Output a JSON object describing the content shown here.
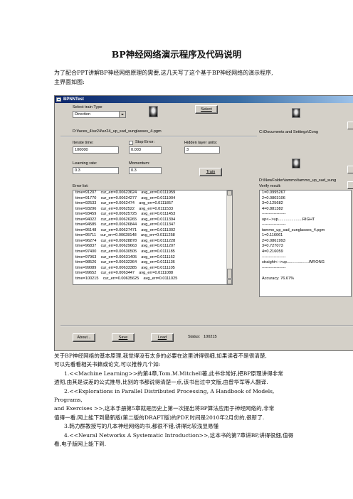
{
  "doc": {
    "title": "BP神经网络演示程序及代码说明",
    "intro_line1": "为了配合PPT讲解BP神经网络原理的需要,这几天写了这个基于BP神经网络的演示程序,",
    "intro_line2": "主界面如图:"
  },
  "window": {
    "title": "BPNNTest",
    "select_train_type_label": "Select train Type",
    "train_type_value": "Direction",
    "select_button": "Select",
    "train_path": "D:\\faces_4\\sz24\\sz24_up_sad_sunglasses_4.pgm",
    "iterate_time_label": "Iterate time:",
    "iterate_time_value": "100000",
    "stop_error_label": "Stop Error:",
    "stop_error_value": "0.003",
    "hidden_units_label": "Hidden layer units:",
    "hidden_units_value": "3",
    "learning_rate_label": "Learning rate:",
    "learning_rate_value": "0.3",
    "momentum_label": "Momentum:",
    "momentum_value": "0.3",
    "train_button": "Train",
    "error_list_label": "Error list:",
    "error_rows": [
      "time=91207    cur_err=0.00623624    avg_err=0.0111959",
      "time=91770    cur_err=0.00624277    avg_err=0.0111904",
      "time=92533    cur_err=0.0062474    avg_err=0.0111857",
      "time=93296    cur_err=0.0062522    avg_err=0.0111533",
      "time=93459    cur_err=0.00625725    avg_err=0.0111453",
      "time=94022    cur_err=0.00626265    avg_err=0.0111394",
      "time=94585    cur_err=0.00626844    avg_err=0.0111347",
      "time=95148    cur_err=0.00627471    avg_err=0.0111302",
      "time=95711    cur_err=0.00628148    avg_err=0.0111258",
      "time=96274    cur_err=0.00628878    avg_err=0.0111228",
      "time=96837    cur_err=0.00629663    avg_err=0.0111207",
      "time=97400    cur_err=0.00630505    avg_err=0.0111185",
      "time=97963    cur_err=0.00631405    avg_err=0.0111162",
      "time=98526    cur_err=0.00632364    avg_err=0.0111136",
      "time=99089    cur_err=0.00633385    avg_err=0.0111105",
      "time=99652    cur_err=0.0063447    avg_err=0.0111088",
      "time=100215    cur_err=0.00635625    avg_err=0.0111025"
    ],
    "about_button": "About...",
    "save_button": "Save",
    "load_button": "Load",
    "status_label": "Status:",
    "status_value": "100215",
    "right_path_1": "C:\\Documents and Settings\\Cong",
    "right_path_2": "D:\\NewFolder\\tammo\\tammo_up_sad_sung",
    "verify_result_label": "Verify result:",
    "verify_rows": [
      "1=0.0995267",
      "2=0.0803106",
      "3=0.125682",
      "4=0.881382",
      "------------------",
      "up<-->up......................RIGHT",
      "------------------",
      "tammo_up_sad_sunglasses_4.pgm",
      "1=0.116061",
      "2=0.0861993",
      "3=0.727073",
      "4=0.216059",
      "------------------",
      "straight<-->up....................WRONG",
      "------------------",
      "",
      "Accuracy: 76.67%"
    ]
  },
  "body": {
    "para1": "关于BP神经网络的基本原理,我觉得没有太多的必要在这里讲得很细,如果读者不是很清楚,",
    "para1b": "可以先看看相关书籍或论文,可以推荐几个如:",
    "item1": "1.<<Machine Learning>>的第4章,Tom.M.Mitchell著,此书非常好,把BP原理讲得非常",
    "item1b": "透彻,由其是误差的公式推导,比别的书都说得清楚一点,该书出过中文版,由曾华军等人翻译.",
    "item2": "2.<<Explorations in Parallel Distributed Processing, A Handbook of Models, Programs,",
    "item2b": "and Exercises >>,这本手册第5章就是历史上第一次提出将BP算法应用于神经网络的,非常",
    "item2c": "值得一看.网上能下到最新版(第二版的DRAFT版)的PDF,时间是2010年2月份的,很新了.",
    "item3": "3.韩力群教授写的几本神经网络的书,都很不错,讲得比较浅显易懂",
    "item4": "4.<<Neural Networks A Systematic Introduction>>,这本书的第7章讲BP,讲得很细,值得",
    "item4b": "看,电子版网上能下到."
  }
}
